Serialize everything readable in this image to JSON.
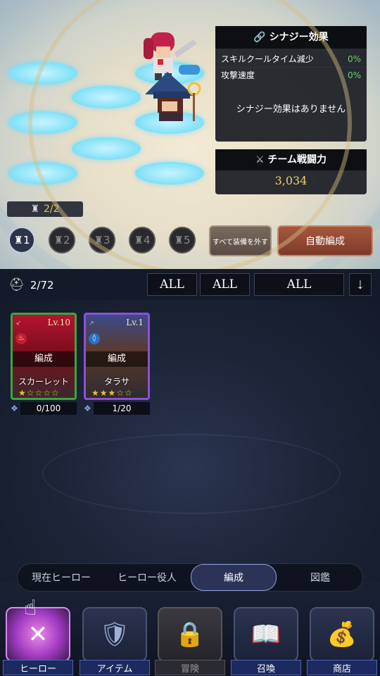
{
  "synergy": {
    "title": "シナジー効果",
    "rows": [
      {
        "label": "スキルクールタイム減少",
        "value": "0%"
      },
      {
        "label": "攻撃速度",
        "value": "0%"
      }
    ],
    "empty_text": "シナジー効果はありません"
  },
  "team_power": {
    "title": "チーム戦闘力",
    "value": "3,034"
  },
  "party_count": "2/2",
  "formation_slots": [
    "1",
    "2",
    "3",
    "4",
    "5"
  ],
  "active_slot": 0,
  "buttons": {
    "unequip_all": "すべて装備を外す",
    "auto_form": "自動編成"
  },
  "hero_count": "2/72",
  "filters": [
    "ALL",
    "ALL",
    "ALL"
  ],
  "sort_icon": "sort-desc-icon",
  "heroes": [
    {
      "level": "Lv.10",
      "action": "編成",
      "name": "スカーレット",
      "stars": "★☆☆☆☆",
      "count": "0/100",
      "frame_color": "#3fa33f"
    },
    {
      "level": "Lv.1",
      "action": "編成",
      "name": "タラサ",
      "stars": "★★★☆☆",
      "count": "1/20",
      "frame_color": "#8d4fd6"
    }
  ],
  "tabs": [
    "現在ヒーロー",
    "ヒーロー役人",
    "編成",
    "図鑑"
  ],
  "active_tab": 2,
  "nav": [
    {
      "label": "ヒーロー",
      "icon": "crossed-swords-icon"
    },
    {
      "label": "アイテム",
      "icon": "sword-shield-icon"
    },
    {
      "label": "冒険",
      "icon": "lock-icon"
    },
    {
      "label": "召喚",
      "icon": "summon-book-icon"
    },
    {
      "label": "商店",
      "icon": "treasure-chest-icon"
    }
  ]
}
